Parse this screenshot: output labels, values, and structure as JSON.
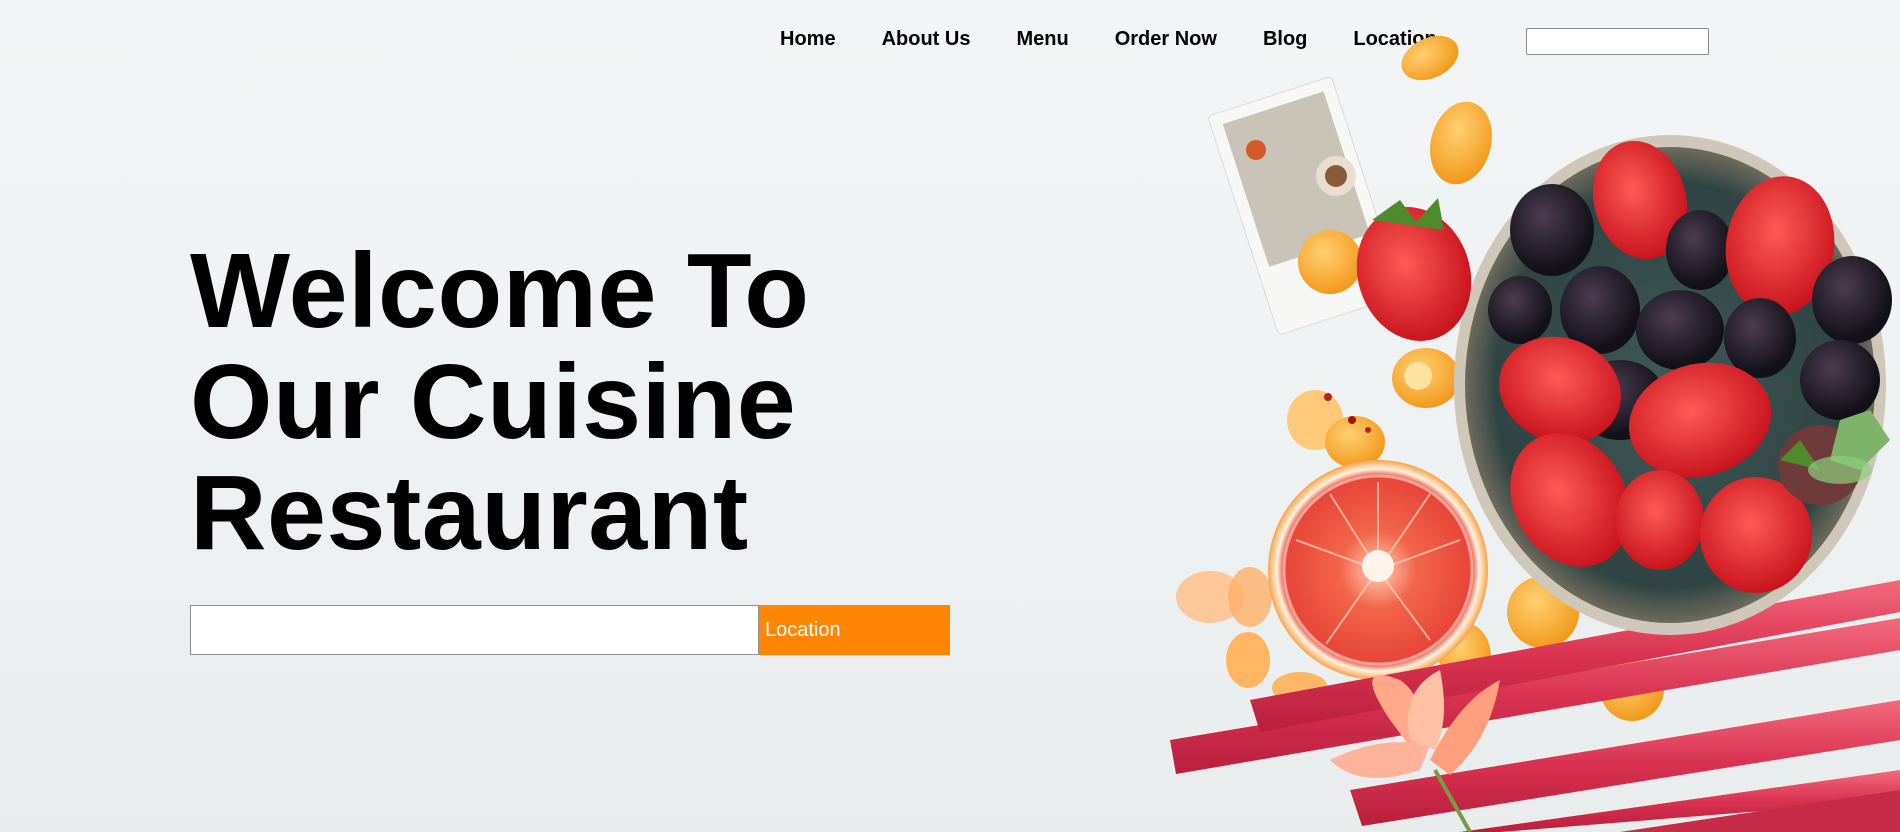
{
  "nav": {
    "items": [
      {
        "label": "Home"
      },
      {
        "label": "About Us"
      },
      {
        "label": "Menu"
      },
      {
        "label": "Order Now"
      },
      {
        "label": "Blog"
      },
      {
        "label": "Location"
      }
    ],
    "search": {
      "value": "",
      "placeholder": ""
    }
  },
  "hero": {
    "title_lines": [
      "Welcome To",
      "Our Cuisine",
      "Restaurant"
    ],
    "search": {
      "value": "",
      "placeholder": ""
    },
    "button_label": "Location"
  },
  "colors": {
    "accent": "#ff8605",
    "text": "#000000",
    "background": "#f0f3f4"
  },
  "image": {
    "subject": "fruit-bowl-with-strawberries-blackberries-blood-orange-rhubarb"
  }
}
